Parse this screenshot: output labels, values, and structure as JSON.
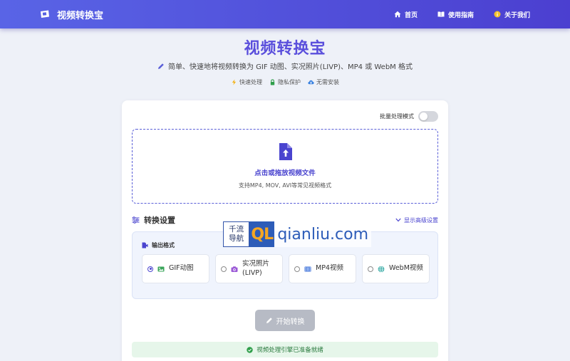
{
  "nav": {
    "brand": "视频转换宝",
    "links": [
      {
        "label": "首页",
        "icon": "home-icon"
      },
      {
        "label": "使用指南",
        "icon": "book-icon"
      },
      {
        "label": "关于我们",
        "icon": "info-icon"
      }
    ]
  },
  "hero": {
    "title": "视频转换宝",
    "subtitle": "简单、快速地将视频转换为 GIF 动图、实况照片(LIVP)、MP4 或 WebM 格式",
    "features": [
      {
        "label": "快速处理",
        "icon": "lightning-icon"
      },
      {
        "label": "隐私保护",
        "icon": "lock-icon"
      },
      {
        "label": "无需安装",
        "icon": "cloud-icon"
      }
    ]
  },
  "card": {
    "batch_label": "批量处理模式",
    "batch_enabled": false,
    "dropzone": {
      "title": "点击或拖放视频文件",
      "subtitle": "支持MP4, MOV, AVI等常见视频格式"
    },
    "settings": {
      "title": "转换设置",
      "advanced_label": "显示高级设置",
      "format_label": "输出格式",
      "options": [
        {
          "label": "GIF动图",
          "selected": true,
          "icon": "image-icon"
        },
        {
          "label": "实况照片(LIVP)",
          "selected": false,
          "icon": "camera-icon"
        },
        {
          "label": "MP4视频",
          "selected": false,
          "icon": "film-icon"
        },
        {
          "label": "WebM视频",
          "selected": false,
          "icon": "globe-icon"
        }
      ]
    },
    "convert_label": "开始转换",
    "status": "视频处理引擎已准备就绪"
  },
  "watermark": {
    "line1": "千流",
    "line2": "导航",
    "ql": "QL",
    "domain": "qianliu.com"
  },
  "colors": {
    "accent": "#4a44cf",
    "nav_start": "#5964e6",
    "nav_end": "#4b3fd0",
    "status_bg": "#e6f6ea",
    "status_text": "#2a7a3e",
    "button_disabled": "#b7bbc5"
  }
}
